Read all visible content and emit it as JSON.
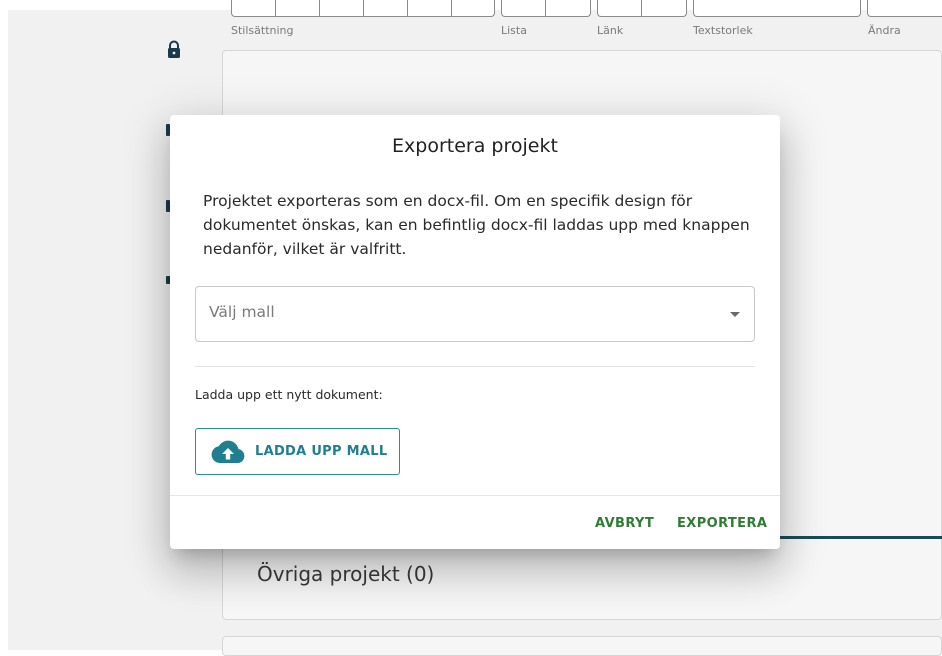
{
  "toolbar": {
    "labels": {
      "styling": "Stilsättning",
      "list": "Lista",
      "link": "Länk",
      "text_size": "Textstorlek",
      "change": "Ändra"
    }
  },
  "background": {
    "other_projects": "Övriga projekt (0)"
  },
  "dialog": {
    "title": "Exportera projekt",
    "body_lines": [
      "Projektet exporteras som en docx-fil. Om en specifik design för",
      "dokumentet önskas, kan en befintlig docx-fil laddas upp med knappen",
      "nedanför, vilket är valfritt."
    ],
    "template_select": {
      "placeholder": "Välj mall"
    },
    "upload_label": "Ladda upp ett nytt dokument:",
    "upload_button": "LADDA UPP MALL",
    "cancel_button": "AVBRYT",
    "export_button": "EXPORTERA"
  },
  "colors": {
    "accent_teal": "#1f7f91",
    "action_green": "#2e7d32",
    "nav_dark": "#1c3a4c"
  }
}
